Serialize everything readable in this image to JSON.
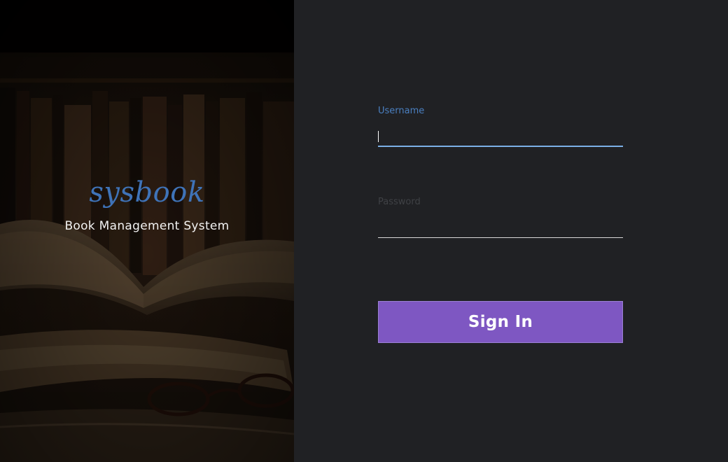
{
  "brand": {
    "title": "sysbook",
    "subtitle": "Book Management System",
    "background_image": "library-books-reading-glasses"
  },
  "login_form": {
    "username": {
      "label": "Username",
      "value": "",
      "focused": true
    },
    "password": {
      "label": "Password",
      "value": ""
    },
    "submit_label": "Sign In"
  },
  "colors": {
    "background": "#202124",
    "accent_blue": "#4a7fc0",
    "focus_underline": "#7bb0e6",
    "button": "#7e57c2",
    "button_text": "#ffffff"
  }
}
